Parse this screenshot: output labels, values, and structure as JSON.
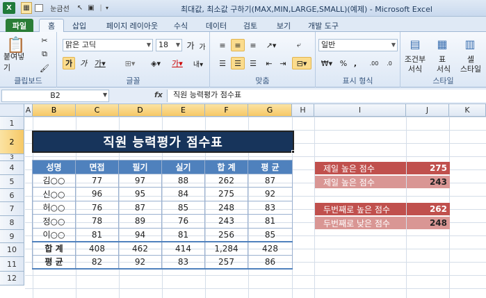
{
  "window": {
    "title": "최대값, 최소값 구하기(MAX,MIN,LARGE,SMALL)(예제)  -  Microsoft Excel",
    "quick_access_label": "눈금선"
  },
  "tabs": [
    "파일",
    "홈",
    "삽입",
    "페이지 레이아웃",
    "수식",
    "데이터",
    "검토",
    "보기",
    "개발 도구"
  ],
  "ribbon": {
    "paste_label": "붙여넣기",
    "font_name": "맑은 고딕",
    "font_size": "18",
    "number_format": "일반",
    "groups": {
      "clipboard": "클립보드",
      "font": "글꼴",
      "alignment": "맞춤",
      "number": "표시 형식",
      "styles": "스타일"
    },
    "cond_format": "조건부",
    "cond_format_2": "서식",
    "table_format": "표",
    "table_format_2": "서식",
    "cell_style": "셀",
    "cell_style_2": "스타일"
  },
  "formula_bar": {
    "name_box": "B2",
    "fx": "fx",
    "formula": "직원 능력평가 점수표"
  },
  "columns": [
    "A",
    "B",
    "C",
    "D",
    "E",
    "F",
    "G",
    "H",
    "I",
    "J",
    "K"
  ],
  "rows": [
    "1",
    "2",
    "3",
    "4",
    "5",
    "6",
    "7",
    "8",
    "9",
    "10",
    "11",
    "12"
  ],
  "sheet": {
    "title": "직원 능력평가 점수표",
    "headers": [
      "성명",
      "면접",
      "필기",
      "실기",
      "합 계",
      "평 균"
    ],
    "records": [
      [
        "김○○",
        "77",
        "97",
        "88",
        "262",
        "87"
      ],
      [
        "신○○",
        "96",
        "95",
        "84",
        "275",
        "92"
      ],
      [
        "허○○",
        "76",
        "87",
        "85",
        "248",
        "83"
      ],
      [
        "정○○",
        "78",
        "89",
        "76",
        "243",
        "81"
      ],
      [
        "이○○",
        "81",
        "94",
        "81",
        "256",
        "85"
      ]
    ],
    "total_row": [
      "합 계",
      "408",
      "462",
      "414",
      "1,284",
      "428"
    ],
    "avg_row": [
      "평 균",
      "82",
      "92",
      "83",
      "257",
      "86"
    ]
  },
  "stats": [
    {
      "label": "제일 높은 점수",
      "value": "275"
    },
    {
      "label": "제일 높은 점수",
      "value": "243"
    },
    {
      "label": "두번째로 높은 점수",
      "value": "262"
    },
    {
      "label": "두번째로 낮은 점수",
      "value": "248"
    }
  ],
  "colors": {
    "dark_red": "#c0504d",
    "light_red": "#d99694",
    "header_blue": "#4f81bd",
    "banner": "#17345b"
  }
}
